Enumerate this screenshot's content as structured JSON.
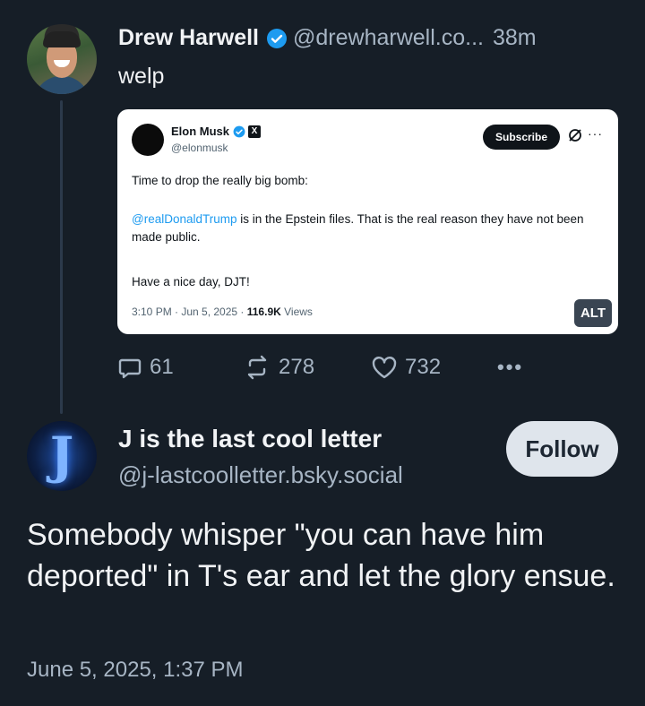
{
  "colors": {
    "background": "#161e27",
    "muted_text": "#a7b5c4",
    "verified_blue": "#1d9bf0",
    "follow_bg": "#dfe5ec"
  },
  "post": {
    "author_name": "Drew Harwell",
    "handle": "@drewharwell.co...",
    "timestamp": "38m",
    "text": "welp",
    "avatar_icon": "avatar-photo",
    "verified_icon": "verified-badge-icon"
  },
  "embed": {
    "author_name": "Elon Musk",
    "handle": "@elonmusk",
    "subscribe_label": "Subscribe",
    "more_label": "···",
    "line1": "Time to drop the really big bomb:",
    "mention": "@realDonaldTrump",
    "line2_rest": " is in the Epstein files. That is the real reason they have not been made public.",
    "line3": "Have a nice day, DJT!",
    "meta_prefix": "3:10 PM · Jun 5, 2025 · ",
    "views_count": "116.9K",
    "views_label": " Views",
    "alt_label": "ALT"
  },
  "actions": {
    "replies": "61",
    "reposts": "278",
    "likes": "732",
    "more": "•••"
  },
  "reply": {
    "author_name": "J is the last cool letter",
    "handle": "@j-lastcoolletter.bsky.social",
    "follow_label": "Follow",
    "avatar_letter": "J",
    "text": "Somebody whisper \"you can have him deported\" in T's ear and let the glory ensue.",
    "date": "June 5, 2025, 1:37 PM"
  }
}
